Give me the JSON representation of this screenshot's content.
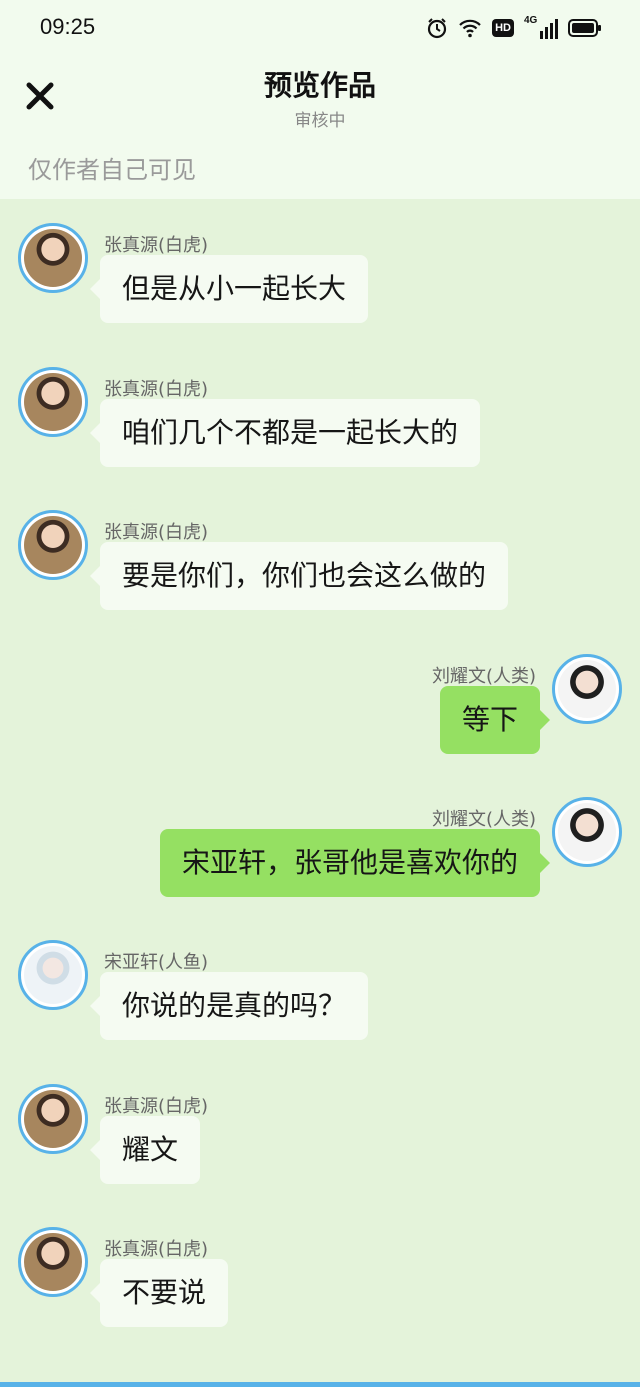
{
  "status_bar": {
    "time": "09:25",
    "network": "4G",
    "hd_badge": "HD",
    "icons": [
      "alarm-icon",
      "wifi-icon",
      "hd-icon",
      "signal-icon",
      "battery-icon"
    ]
  },
  "header": {
    "title": "预览作品",
    "subtitle": "审核中",
    "close_icon": "close-icon"
  },
  "visibility_note": "仅作者自己可见",
  "colors": {
    "header_bg": "#f2fbee",
    "chat_bg": "#e4f3da",
    "left_bubble": "#f5fbf2",
    "right_bubble": "#95e062",
    "avatar_ring": "#58b2e8"
  },
  "messages": [
    {
      "side": "left",
      "avatar": "avatar-zhang",
      "sender": "张真源(白虎)",
      "text": "但是从小一起长大"
    },
    {
      "side": "left",
      "avatar": "avatar-zhang",
      "sender": "张真源(白虎)",
      "text": "咱们几个不都是一起长大的"
    },
    {
      "side": "left",
      "avatar": "avatar-zhang",
      "sender": "张真源(白虎)",
      "text": "要是你们，你们也会这么做的"
    },
    {
      "side": "right",
      "avatar": "avatar-liu",
      "sender": "刘耀文(人类)",
      "text": "等下"
    },
    {
      "side": "right",
      "avatar": "avatar-liu",
      "sender": "刘耀文(人类)",
      "text": "宋亚轩，张哥他是喜欢你的"
    },
    {
      "side": "left",
      "avatar": "avatar-song",
      "sender": "宋亚轩(人鱼)",
      "text": "你说的是真的吗？"
    },
    {
      "side": "left",
      "avatar": "avatar-zhang",
      "sender": "张真源(白虎)",
      "text": "耀文"
    },
    {
      "side": "left",
      "avatar": "avatar-zhang",
      "sender": "张真源(白虎)",
      "text": "不要说"
    }
  ]
}
